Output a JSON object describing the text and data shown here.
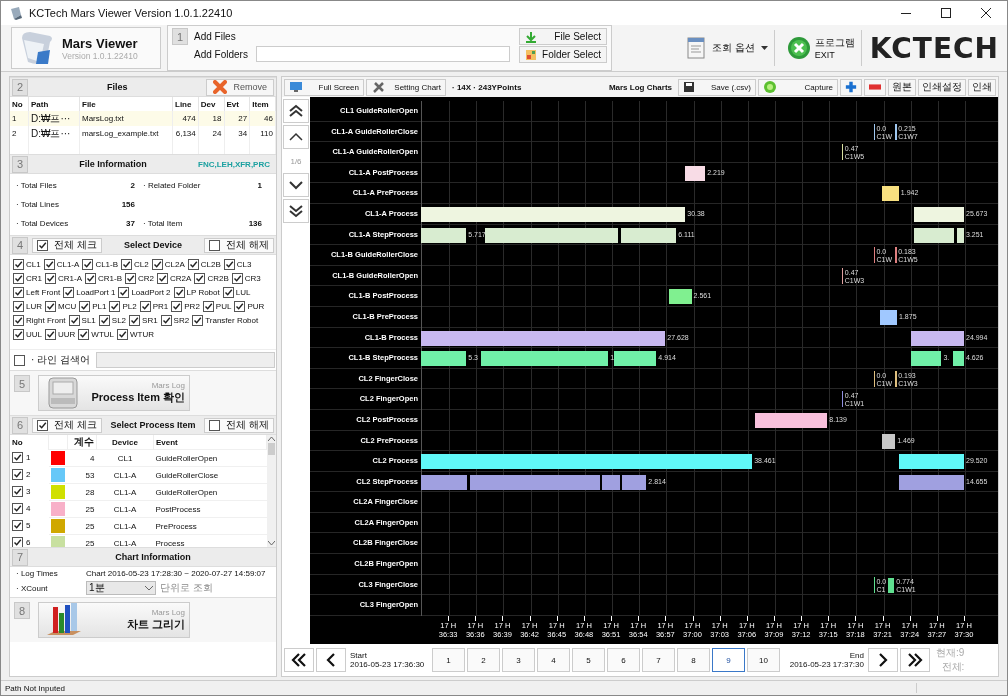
{
  "window": {
    "title": "KCTech Mars Viewer Version 1.0.1.22410"
  },
  "app": {
    "name": "Mars Viewer",
    "version": "Version 1.0.1.22410"
  },
  "add_panel": {
    "step": "1",
    "add_files": "Add Files",
    "add_folders": "Add Folders",
    "buttons": [
      "File Select",
      "Folder Select"
    ]
  },
  "view_options": {
    "label": "조회 옵션"
  },
  "exit": {
    "label": "프로그램",
    "sublabel": "EXIT"
  },
  "logo": "KCTECH",
  "files": {
    "step": "2",
    "title": "Files",
    "remove": "Remove",
    "columns": [
      "No",
      "Path",
      "File",
      "Line",
      "Dev",
      "Evt",
      "Item"
    ],
    "rows": [
      {
        "cells": [
          "1",
          "D:₩프···",
          "MarsLog.txt",
          "474",
          "18",
          "27",
          "46"
        ],
        "selected": true
      },
      {
        "cells": [
          "2",
          "D:₩프···",
          "marsLog_example.txt",
          "6,134",
          "24",
          "34",
          "110"
        ],
        "selected": false
      }
    ]
  },
  "file_info": {
    "step": "3",
    "title": "File Information",
    "types": "FNC,LEH,XFR,PRC",
    "stats": [
      {
        "items": [
          {
            "label": "· Total Files",
            "value": "2"
          },
          {
            "label": "· Related Folder",
            "value": "1"
          }
        ]
      },
      {
        "items": [
          {
            "label": "· Total Lines",
            "value": "156"
          }
        ]
      },
      {
        "items": [
          {
            "label": "· Total Devices",
            "value": "37"
          },
          {
            "label": "· Total Item",
            "value": "136"
          }
        ]
      }
    ]
  },
  "select_device": {
    "step": "4",
    "check_all": {
      "label": "전체 체크",
      "checked": true
    },
    "title": "Select Device",
    "uncheck_all": {
      "label": "전체 해제",
      "checked": false
    },
    "devices": [
      {
        "name": "CL1",
        "checked": true
      },
      {
        "name": "CL1-A",
        "checked": true
      },
      {
        "name": "CL1-B",
        "checked": true
      },
      {
        "name": "CL2",
        "checked": true
      },
      {
        "name": "CL2A",
        "checked": true
      },
      {
        "name": "CL2B",
        "checked": true
      },
      {
        "name": "CL3",
        "checked": true
      },
      {
        "name": "CR1",
        "checked": true
      },
      {
        "name": "CR1-A",
        "checked": true
      },
      {
        "name": "CR1-B",
        "checked": true
      },
      {
        "name": "CR2",
        "checked": true
      },
      {
        "name": "CR2A",
        "checked": true
      },
      {
        "name": "CR2B",
        "checked": true
      },
      {
        "name": "CR3",
        "checked": true
      },
      {
        "name": "Left Front",
        "checked": true
      },
      {
        "name": "LoadPort 1",
        "checked": true
      },
      {
        "name": "LoadPort 2",
        "checked": true
      },
      {
        "name": "LP Robot",
        "checked": true
      },
      {
        "name": "LUL",
        "checked": true
      },
      {
        "name": "LUR",
        "checked": true
      },
      {
        "name": "MCU",
        "checked": true
      },
      {
        "name": "PL1",
        "checked": true
      },
      {
        "name": "PL2",
        "checked": true
      },
      {
        "name": "PR1",
        "checked": true
      },
      {
        "name": "PR2",
        "checked": true
      },
      {
        "name": "PUL",
        "checked": true
      },
      {
        "name": "PUR",
        "checked": true
      },
      {
        "name": "Right Front",
        "checked": true
      },
      {
        "name": "SL1",
        "checked": true
      },
      {
        "name": "SL2",
        "checked": true
      },
      {
        "name": "SR1",
        "checked": true
      },
      {
        "name": "SR2",
        "checked": true
      },
      {
        "name": "Transfer Robot",
        "checked": true
      },
      {
        "name": "UUL",
        "checked": true
      },
      {
        "name": "UUR",
        "checked": true
      },
      {
        "name": "WTUL",
        "checked": true
      },
      {
        "name": "WTUR",
        "checked": true
      }
    ]
  },
  "line_search": {
    "checked": false,
    "label": "· 라인 검색어"
  },
  "process_button": {
    "step": "5",
    "caption": "Mars Log",
    "label": "Process Item 확인"
  },
  "select_process": {
    "step": "6",
    "check_all": {
      "label": "전체 체크",
      "checked": true
    },
    "title": "Select Process Item",
    "uncheck_all": {
      "label": "전체 해제",
      "checked": false
    },
    "columns": [
      "No",
      "계수",
      "Device",
      "Event"
    ],
    "rows": [
      {
        "no": "1",
        "checked": true,
        "color": "#ff0000",
        "count": "4",
        "device": "CL1",
        "event": "GuideRollerOpen"
      },
      {
        "no": "2",
        "checked": true,
        "color": "#66c8f8",
        "count": "53",
        "device": "CL1-A",
        "event": "GuideRollerClose"
      },
      {
        "no": "3",
        "checked": true,
        "color": "#d0e000",
        "count": "28",
        "device": "CL1-A",
        "event": "GuideRollerOpen"
      },
      {
        "no": "4",
        "checked": true,
        "color": "#f8b0c8",
        "count": "25",
        "device": "CL1-A",
        "event": "PostProcess"
      },
      {
        "no": "5",
        "checked": true,
        "color": "#d0a800",
        "count": "25",
        "device": "CL1-A",
        "event": "PreProcess"
      },
      {
        "no": "6",
        "checked": true,
        "color": "#c8e0a0",
        "count": "25",
        "device": "CL1-A",
        "event": "Process"
      }
    ]
  },
  "chart_info": {
    "step": "7",
    "title": "Chart Information",
    "log_times_label": "· Log Times",
    "log_times": "Chart 2016-05-23 17:28:30 ~ 2020-07-27 14:59:07",
    "xcount_label": "· XCount",
    "xcount": "1분",
    "xcount_suffix": "단위로 조회"
  },
  "draw_button": {
    "step": "8",
    "caption": "Mars Log",
    "label": "차트 그리기"
  },
  "chart_toolbar": {
    "full_screen": "Full Screen",
    "setting": "Setting Chart",
    "points": "· 14X · 243YPoints",
    "title": "Mars Log Charts",
    "save": "Save (.csv)",
    "capture": "Capture",
    "buttons": [
      "원본",
      "인쇄설정",
      "인쇄"
    ]
  },
  "nav": {
    "page": "1/6"
  },
  "gantt": {
    "ticks": [
      {
        "hour": "17 H",
        "time": "36:33"
      },
      {
        "hour": "17 H",
        "time": "36:36"
      },
      {
        "hour": "17 H",
        "time": "36:39"
      },
      {
        "hour": "17 H",
        "time": "36:42"
      },
      {
        "hour": "17 H",
        "time": "36:45"
      },
      {
        "hour": "17 H",
        "time": "36:48"
      },
      {
        "hour": "17 H",
        "time": "36:51"
      },
      {
        "hour": "17 H",
        "time": "36:54"
      },
      {
        "hour": "17 H",
        "time": "36:57"
      },
      {
        "hour": "17 H",
        "time": "37:00"
      },
      {
        "hour": "17 H",
        "time": "37:03"
      },
      {
        "hour": "17 H",
        "time": "37:06"
      },
      {
        "hour": "17 H",
        "time": "37:09"
      },
      {
        "hour": "17 H",
        "time": "37:12"
      },
      {
        "hour": "17 H",
        "time": "37:15"
      },
      {
        "hour": "17 H",
        "time": "37:18"
      },
      {
        "hour": "17 H",
        "time": "37:21"
      },
      {
        "hour": "17 H",
        "time": "37:24"
      },
      {
        "hour": "17 H",
        "time": "37:27"
      },
      {
        "hour": "17 H",
        "time": "37:30"
      }
    ],
    "rows": [
      {
        "label": "CL1 GuideRollerOpen",
        "items": []
      },
      {
        "label": "CL1-A GuideRollerClose",
        "items": [
          {
            "kind": "mark",
            "color": "#a0c8f0",
            "value": "0.0",
            "tag": "C1W"
          },
          {
            "kind": "mark",
            "color": "#a0c8f0",
            "value": "0.215",
            "tag": "C1W7"
          }
        ]
      },
      {
        "label": "CL1-A GuideRollerOpen",
        "items": [
          {
            "kind": "mark",
            "color": "#d8e0a0",
            "value": "0.47",
            "tag": "C1W5"
          }
        ]
      },
      {
        "label": "CL1-A PostProcess",
        "items": [
          {
            "kind": "bar",
            "color": "#f8dce6",
            "label": "2.219"
          }
        ]
      },
      {
        "label": "CL1-A PreProcess",
        "items": [
          {
            "kind": "bar",
            "color": "#f8e080",
            "label": "1.942"
          }
        ]
      },
      {
        "label": "CL1-A Process",
        "items": [
          {
            "kind": "bar",
            "color": "#eef5e0",
            "label": "30.38"
          },
          {
            "kind": "bar",
            "color": "#eef5e0",
            "label": "25.673"
          }
        ]
      },
      {
        "label": "CL1-A StepProcess",
        "items": [
          {
            "kind": "bar",
            "color": "#d8ecd0",
            "label": "5.717"
          },
          {
            "kind": "bar",
            "color": "#d8ecd0"
          },
          {
            "kind": "bar",
            "color": "#d8ecd0",
            "label": "6.111"
          },
          {
            "kind": "bar",
            "color": "#d8ecd0"
          },
          {
            "kind": "bar",
            "color": "#d8ecd0",
            "label": "3.251"
          }
        ]
      },
      {
        "label": "CL1-B GuideRollerClose",
        "items": [
          {
            "kind": "mark",
            "color": "#e08080",
            "value": "0.0",
            "tag": "C1W"
          },
          {
            "kind": "mark",
            "color": "#e08080",
            "value": "0.183",
            "tag": "C1W5"
          }
        ]
      },
      {
        "label": "CL1-B GuideRollerOpen",
        "items": [
          {
            "kind": "mark",
            "color": "#e0a0a0",
            "value": "0.47",
            "tag": "C1W3"
          }
        ]
      },
      {
        "label": "CL1-B PostProcess",
        "items": [
          {
            "kind": "bar",
            "color": "#80f090",
            "label": "2.561"
          }
        ]
      },
      {
        "label": "CL1-B PreProcess",
        "items": [
          {
            "kind": "bar",
            "color": "#a0c8ff",
            "label": "1.875"
          }
        ]
      },
      {
        "label": "CL1-B Process",
        "items": [
          {
            "kind": "bar",
            "color": "#c8b8f0",
            "label": "27.628"
          },
          {
            "kind": "bar",
            "color": "#c8b8f0",
            "label": "24.994"
          }
        ]
      },
      {
        "label": "CL1-B StepProcess",
        "items": [
          {
            "kind": "bar",
            "color": "#70f0a8",
            "label": "5.3"
          },
          {
            "kind": "bar",
            "color": "#70f0a8",
            "label": "1"
          },
          {
            "kind": "bar",
            "color": "#70f0a8",
            "label": "4.914"
          },
          {
            "kind": "bar",
            "color": "#70f0a8",
            "label": "3."
          },
          {
            "kind": "bar",
            "color": "#70f0a8",
            "label": "4.626"
          }
        ]
      },
      {
        "label": "CL2 FingerClose",
        "items": [
          {
            "kind": "mark",
            "color": "#e0c080",
            "value": "0.0",
            "tag": "C1W"
          },
          {
            "kind": "mark",
            "color": "#e0c080",
            "value": "0.193",
            "tag": "C1W3"
          }
        ]
      },
      {
        "label": "CL2 FingerOpen",
        "items": [
          {
            "kind": "mark",
            "color": "#9090e0",
            "value": "0.47",
            "tag": "C1W1"
          }
        ]
      },
      {
        "label": "CL2 PostProcess",
        "items": [
          {
            "kind": "bar",
            "color": "#f8c0dc",
            "label": "8.139"
          }
        ]
      },
      {
        "label": "CL2 PreProcess",
        "items": [
          {
            "kind": "bar",
            "color": "#c8c8c8",
            "label": "1.469"
          }
        ]
      },
      {
        "label": "CL2 Process",
        "items": [
          {
            "kind": "bar",
            "color": "#60f8f8",
            "label": "38.461"
          },
          {
            "kind": "bar",
            "color": "#60f8f8",
            "label": "29.520"
          }
        ]
      },
      {
        "label": "CL2 StepProcess",
        "items": [
          {
            "kind": "bar",
            "color": "#a0a0e0"
          },
          {
            "kind": "bar",
            "color": "#a0a0e0"
          },
          {
            "kind": "bar",
            "color": "#a0a0e0"
          },
          {
            "kind": "bar",
            "color": "#a0a0e0",
            "label": "2.814"
          },
          {
            "kind": "bar",
            "color": "#a0a0e0",
            "label": "14.655"
          }
        ]
      },
      {
        "label": "CL2A FingerClose",
        "items": []
      },
      {
        "label": "CL2A FingerOpen",
        "items": []
      },
      {
        "label": "CL2B FingerClose",
        "items": []
      },
      {
        "label": "CL2B FingerOpen",
        "items": []
      },
      {
        "label": "CL3 FingerClose",
        "items": [
          {
            "kind": "mark",
            "color": "#60e090",
            "value": "0.0",
            "tag": "C1"
          },
          {
            "kind": "bar",
            "color": "#60e090",
            "label": "0.774",
            "tag": "C1W1"
          }
        ]
      },
      {
        "label": "CL3 FingerOpen",
        "items": []
      }
    ]
  },
  "pager": {
    "start_label": "Start",
    "start": "2016-05-23 17:36:30",
    "pages": [
      {
        "label": "1",
        "selected": false
      },
      {
        "label": "2",
        "selected": false
      },
      {
        "label": "3",
        "selected": false
      },
      {
        "label": "4",
        "selected": false
      },
      {
        "label": "5",
        "selected": false
      },
      {
        "label": "6",
        "selected": false
      },
      {
        "label": "7",
        "selected": false
      },
      {
        "label": "8",
        "selected": false
      },
      {
        "label": "9",
        "selected": true
      },
      {
        "label": "10",
        "selected": false
      }
    ],
    "end_label": "End",
    "end": "2016-05-23 17:37:30",
    "current": "현재:9",
    "total": "전체:"
  },
  "status_bar": "Path Not Inputed"
}
